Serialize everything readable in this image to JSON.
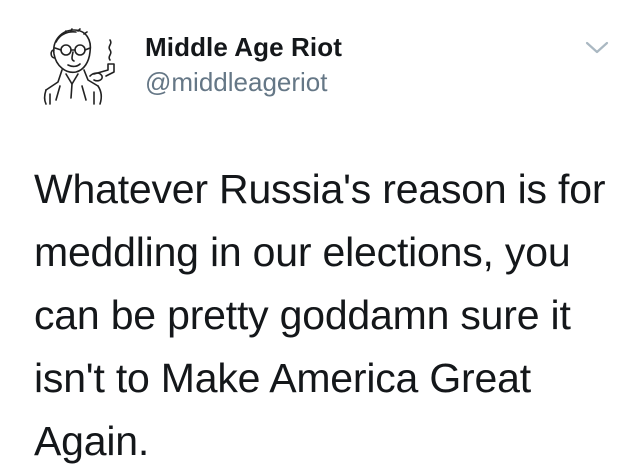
{
  "tweet": {
    "author": {
      "display_name": "Middle Age Riot",
      "handle": "@middleageriot",
      "avatar_icon": "cartoon-man-with-pipe-icon"
    },
    "menu_icon": "chevron-down-icon",
    "text": "Whatever Russia's reason is for\nmeddling in our elections, you\ncan be pretty goddamn sure it\nisn't to Make America Great\nAgain."
  },
  "colors": {
    "text_primary": "#14171a",
    "text_secondary": "#657786",
    "caret": "#aab8c2",
    "background": "#ffffff"
  }
}
